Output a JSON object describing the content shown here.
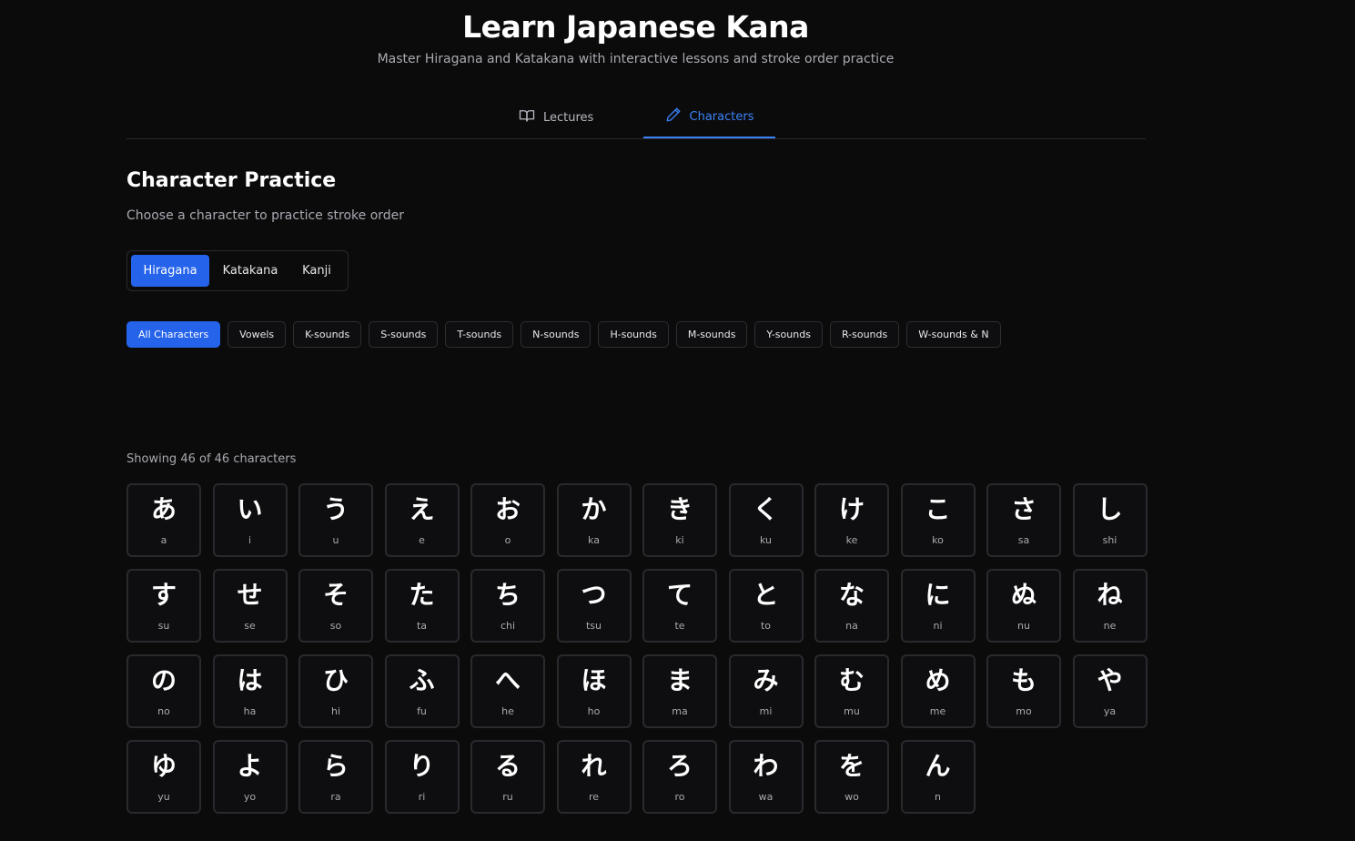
{
  "header": {
    "title": "Learn Japanese Kana",
    "subtitle": "Master Hiragana and Katakana with interactive lessons and stroke order practice"
  },
  "tabs": [
    {
      "label": "Lectures",
      "icon": "book-open-icon",
      "active": false
    },
    {
      "label": "Characters",
      "icon": "pencil-icon",
      "active": true
    }
  ],
  "section": {
    "title": "Character Practice",
    "subtitle": "Choose a character to practice stroke order"
  },
  "script_switch": [
    "Hiragana",
    "Katakana",
    "Kanji"
  ],
  "script_selected": "Hiragana",
  "filters": [
    "All Characters",
    "Vowels",
    "K-sounds",
    "S-sounds",
    "T-sounds",
    "N-sounds",
    "H-sounds",
    "M-sounds",
    "Y-sounds",
    "R-sounds",
    "W-sounds & N"
  ],
  "filter_selected": "All Characters",
  "count_text": "Showing 46 of 46 characters",
  "characters": [
    {
      "kana": "あ",
      "romaji": "a"
    },
    {
      "kana": "い",
      "romaji": "i"
    },
    {
      "kana": "う",
      "romaji": "u"
    },
    {
      "kana": "え",
      "romaji": "e"
    },
    {
      "kana": "お",
      "romaji": "o"
    },
    {
      "kana": "か",
      "romaji": "ka"
    },
    {
      "kana": "き",
      "romaji": "ki"
    },
    {
      "kana": "く",
      "romaji": "ku"
    },
    {
      "kana": "け",
      "romaji": "ke"
    },
    {
      "kana": "こ",
      "romaji": "ko"
    },
    {
      "kana": "さ",
      "romaji": "sa"
    },
    {
      "kana": "し",
      "romaji": "shi"
    },
    {
      "kana": "す",
      "romaji": "su"
    },
    {
      "kana": "せ",
      "romaji": "se"
    },
    {
      "kana": "そ",
      "romaji": "so"
    },
    {
      "kana": "た",
      "romaji": "ta"
    },
    {
      "kana": "ち",
      "romaji": "chi"
    },
    {
      "kana": "つ",
      "romaji": "tsu"
    },
    {
      "kana": "て",
      "romaji": "te"
    },
    {
      "kana": "と",
      "romaji": "to"
    },
    {
      "kana": "な",
      "romaji": "na"
    },
    {
      "kana": "に",
      "romaji": "ni"
    },
    {
      "kana": "ぬ",
      "romaji": "nu"
    },
    {
      "kana": "ね",
      "romaji": "ne"
    },
    {
      "kana": "の",
      "romaji": "no"
    },
    {
      "kana": "は",
      "romaji": "ha"
    },
    {
      "kana": "ひ",
      "romaji": "hi"
    },
    {
      "kana": "ふ",
      "romaji": "fu"
    },
    {
      "kana": "へ",
      "romaji": "he"
    },
    {
      "kana": "ほ",
      "romaji": "ho"
    },
    {
      "kana": "ま",
      "romaji": "ma"
    },
    {
      "kana": "み",
      "romaji": "mi"
    },
    {
      "kana": "む",
      "romaji": "mu"
    },
    {
      "kana": "め",
      "romaji": "me"
    },
    {
      "kana": "も",
      "romaji": "mo"
    },
    {
      "kana": "や",
      "romaji": "ya"
    },
    {
      "kana": "ゆ",
      "romaji": "yu"
    },
    {
      "kana": "よ",
      "romaji": "yo"
    },
    {
      "kana": "ら",
      "romaji": "ra"
    },
    {
      "kana": "り",
      "romaji": "ri"
    },
    {
      "kana": "る",
      "romaji": "ru"
    },
    {
      "kana": "れ",
      "romaji": "re"
    },
    {
      "kana": "ろ",
      "romaji": "ro"
    },
    {
      "kana": "わ",
      "romaji": "wa"
    },
    {
      "kana": "を",
      "romaji": "wo"
    },
    {
      "kana": "ん",
      "romaji": "n"
    }
  ],
  "colors": {
    "background": "#0b0b0c",
    "accent": "#2563eb",
    "tab_accent": "#3b82f6",
    "border": "#2a2a2e"
  }
}
